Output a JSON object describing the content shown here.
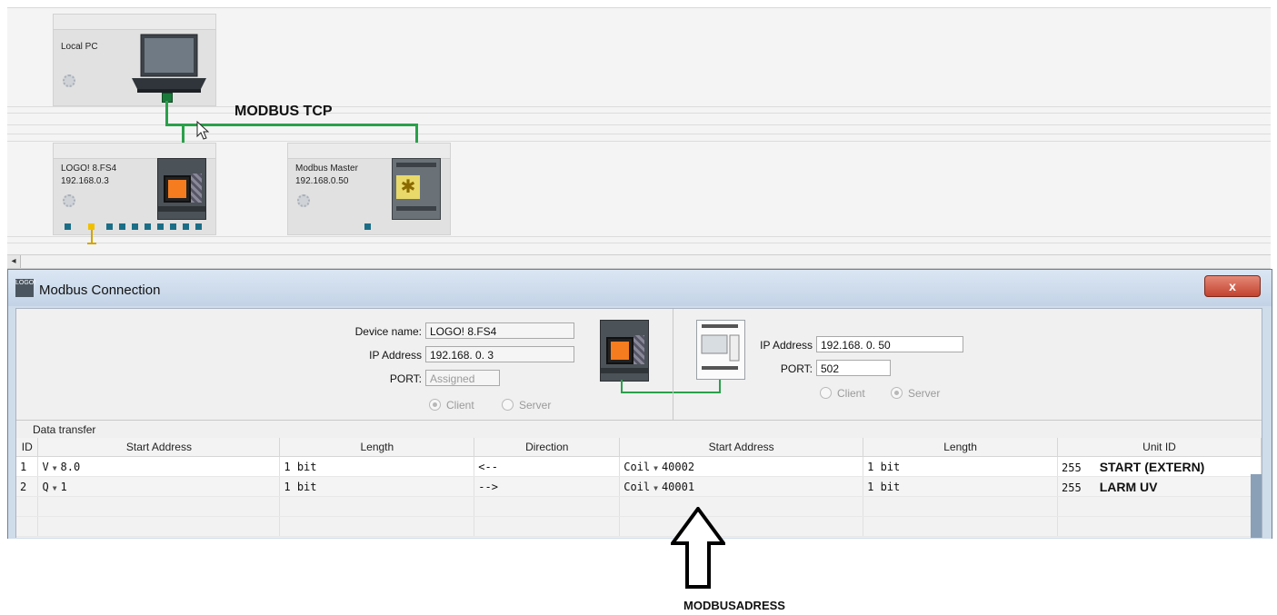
{
  "network": {
    "local_pc_label": "Local PC",
    "connection_label": "MODBUS TCP",
    "logo_name": "LOGO! 8.FS4",
    "logo_ip": "192.168.0.3",
    "modbus_master_name": "Modbus Master",
    "modbus_master_ip": "192.168.0.50"
  },
  "dialog": {
    "title": "Modbus Connection",
    "icon_text": "LOGO!",
    "close_label": "x",
    "left": {
      "device_name_label": "Device name:",
      "device_name_value": "LOGO! 8.FS4",
      "ip_label": "IP Address",
      "ip_value": "192.168.  0.  3",
      "port_label": "PORT:",
      "port_value": "Assigned",
      "client_label": "Client",
      "server_label": "Server",
      "selected_mode": "Client"
    },
    "right": {
      "ip_label": "IP Address",
      "ip_value": "192.168.  0. 50",
      "port_label": "PORT:",
      "port_value": "502",
      "client_label": "Client",
      "server_label": "Server",
      "selected_mode": "Server"
    },
    "data_transfer_label": "Data transfer",
    "columns": [
      "ID",
      "Start Address",
      "Length",
      "Direction",
      "Start Address",
      "Length",
      "Unit ID"
    ],
    "rows": [
      {
        "id": "1",
        "local_type": "V",
        "local_addr": "8.0",
        "length": "1 bit",
        "direction": "<--",
        "remote_type": "Coil",
        "remote_addr": "40002",
        "remote_length": "1 bit",
        "unit_id": "255",
        "tag": "START (EXTERN)"
      },
      {
        "id": "2",
        "local_type": "Q",
        "local_addr": "1",
        "length": "1 bit",
        "direction": "-->",
        "remote_type": "Coil",
        "remote_addr": "40001",
        "remote_length": "1 bit",
        "unit_id": "255",
        "tag": "LARM UV"
      }
    ]
  },
  "annotation": {
    "caption": "MODBUSADRESS"
  },
  "colors": {
    "wire": "#2aa04a",
    "plc_screen": "#f57c1f",
    "close_button": "#c2432e",
    "title_bar": "#c3d3e6"
  }
}
